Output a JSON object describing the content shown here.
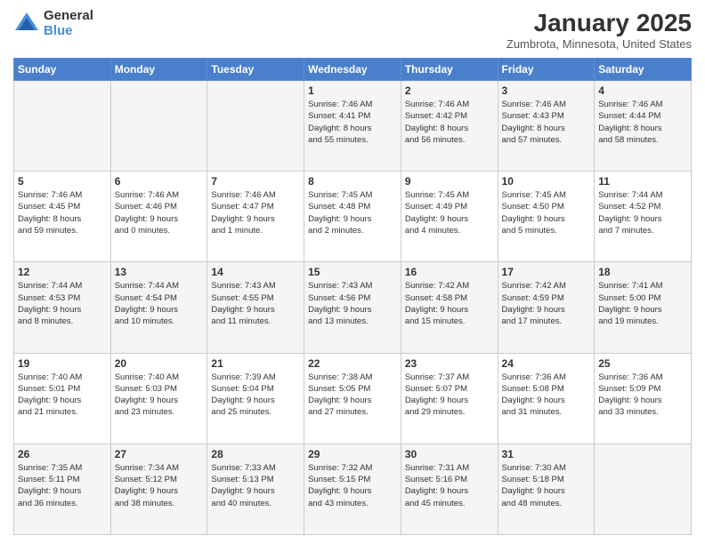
{
  "logo": {
    "general": "General",
    "blue": "Blue"
  },
  "header": {
    "month": "January 2025",
    "location": "Zumbrota, Minnesota, United States"
  },
  "weekdays": [
    "Sunday",
    "Monday",
    "Tuesday",
    "Wednesday",
    "Thursday",
    "Friday",
    "Saturday"
  ],
  "weeks": [
    [
      {
        "day": "",
        "info": ""
      },
      {
        "day": "",
        "info": ""
      },
      {
        "day": "",
        "info": ""
      },
      {
        "day": "1",
        "info": "Sunrise: 7:46 AM\nSunset: 4:41 PM\nDaylight: 8 hours\nand 55 minutes."
      },
      {
        "day": "2",
        "info": "Sunrise: 7:46 AM\nSunset: 4:42 PM\nDaylight: 8 hours\nand 56 minutes."
      },
      {
        "day": "3",
        "info": "Sunrise: 7:46 AM\nSunset: 4:43 PM\nDaylight: 8 hours\nand 57 minutes."
      },
      {
        "day": "4",
        "info": "Sunrise: 7:46 AM\nSunset: 4:44 PM\nDaylight: 8 hours\nand 58 minutes."
      }
    ],
    [
      {
        "day": "5",
        "info": "Sunrise: 7:46 AM\nSunset: 4:45 PM\nDaylight: 8 hours\nand 59 minutes."
      },
      {
        "day": "6",
        "info": "Sunrise: 7:46 AM\nSunset: 4:46 PM\nDaylight: 9 hours\nand 0 minutes."
      },
      {
        "day": "7",
        "info": "Sunrise: 7:46 AM\nSunset: 4:47 PM\nDaylight: 9 hours\nand 1 minute."
      },
      {
        "day": "8",
        "info": "Sunrise: 7:45 AM\nSunset: 4:48 PM\nDaylight: 9 hours\nand 2 minutes."
      },
      {
        "day": "9",
        "info": "Sunrise: 7:45 AM\nSunset: 4:49 PM\nDaylight: 9 hours\nand 4 minutes."
      },
      {
        "day": "10",
        "info": "Sunrise: 7:45 AM\nSunset: 4:50 PM\nDaylight: 9 hours\nand 5 minutes."
      },
      {
        "day": "11",
        "info": "Sunrise: 7:44 AM\nSunset: 4:52 PM\nDaylight: 9 hours\nand 7 minutes."
      }
    ],
    [
      {
        "day": "12",
        "info": "Sunrise: 7:44 AM\nSunset: 4:53 PM\nDaylight: 9 hours\nand 8 minutes."
      },
      {
        "day": "13",
        "info": "Sunrise: 7:44 AM\nSunset: 4:54 PM\nDaylight: 9 hours\nand 10 minutes."
      },
      {
        "day": "14",
        "info": "Sunrise: 7:43 AM\nSunset: 4:55 PM\nDaylight: 9 hours\nand 11 minutes."
      },
      {
        "day": "15",
        "info": "Sunrise: 7:43 AM\nSunset: 4:56 PM\nDaylight: 9 hours\nand 13 minutes."
      },
      {
        "day": "16",
        "info": "Sunrise: 7:42 AM\nSunset: 4:58 PM\nDaylight: 9 hours\nand 15 minutes."
      },
      {
        "day": "17",
        "info": "Sunrise: 7:42 AM\nSunset: 4:59 PM\nDaylight: 9 hours\nand 17 minutes."
      },
      {
        "day": "18",
        "info": "Sunrise: 7:41 AM\nSunset: 5:00 PM\nDaylight: 9 hours\nand 19 minutes."
      }
    ],
    [
      {
        "day": "19",
        "info": "Sunrise: 7:40 AM\nSunset: 5:01 PM\nDaylight: 9 hours\nand 21 minutes."
      },
      {
        "day": "20",
        "info": "Sunrise: 7:40 AM\nSunset: 5:03 PM\nDaylight: 9 hours\nand 23 minutes."
      },
      {
        "day": "21",
        "info": "Sunrise: 7:39 AM\nSunset: 5:04 PM\nDaylight: 9 hours\nand 25 minutes."
      },
      {
        "day": "22",
        "info": "Sunrise: 7:38 AM\nSunset: 5:05 PM\nDaylight: 9 hours\nand 27 minutes."
      },
      {
        "day": "23",
        "info": "Sunrise: 7:37 AM\nSunset: 5:07 PM\nDaylight: 9 hours\nand 29 minutes."
      },
      {
        "day": "24",
        "info": "Sunrise: 7:36 AM\nSunset: 5:08 PM\nDaylight: 9 hours\nand 31 minutes."
      },
      {
        "day": "25",
        "info": "Sunrise: 7:36 AM\nSunset: 5:09 PM\nDaylight: 9 hours\nand 33 minutes."
      }
    ],
    [
      {
        "day": "26",
        "info": "Sunrise: 7:35 AM\nSunset: 5:11 PM\nDaylight: 9 hours\nand 36 minutes."
      },
      {
        "day": "27",
        "info": "Sunrise: 7:34 AM\nSunset: 5:12 PM\nDaylight: 9 hours\nand 38 minutes."
      },
      {
        "day": "28",
        "info": "Sunrise: 7:33 AM\nSunset: 5:13 PM\nDaylight: 9 hours\nand 40 minutes."
      },
      {
        "day": "29",
        "info": "Sunrise: 7:32 AM\nSunset: 5:15 PM\nDaylight: 9 hours\nand 43 minutes."
      },
      {
        "day": "30",
        "info": "Sunrise: 7:31 AM\nSunset: 5:16 PM\nDaylight: 9 hours\nand 45 minutes."
      },
      {
        "day": "31",
        "info": "Sunrise: 7:30 AM\nSunset: 5:18 PM\nDaylight: 9 hours\nand 48 minutes."
      },
      {
        "day": "",
        "info": ""
      }
    ]
  ]
}
